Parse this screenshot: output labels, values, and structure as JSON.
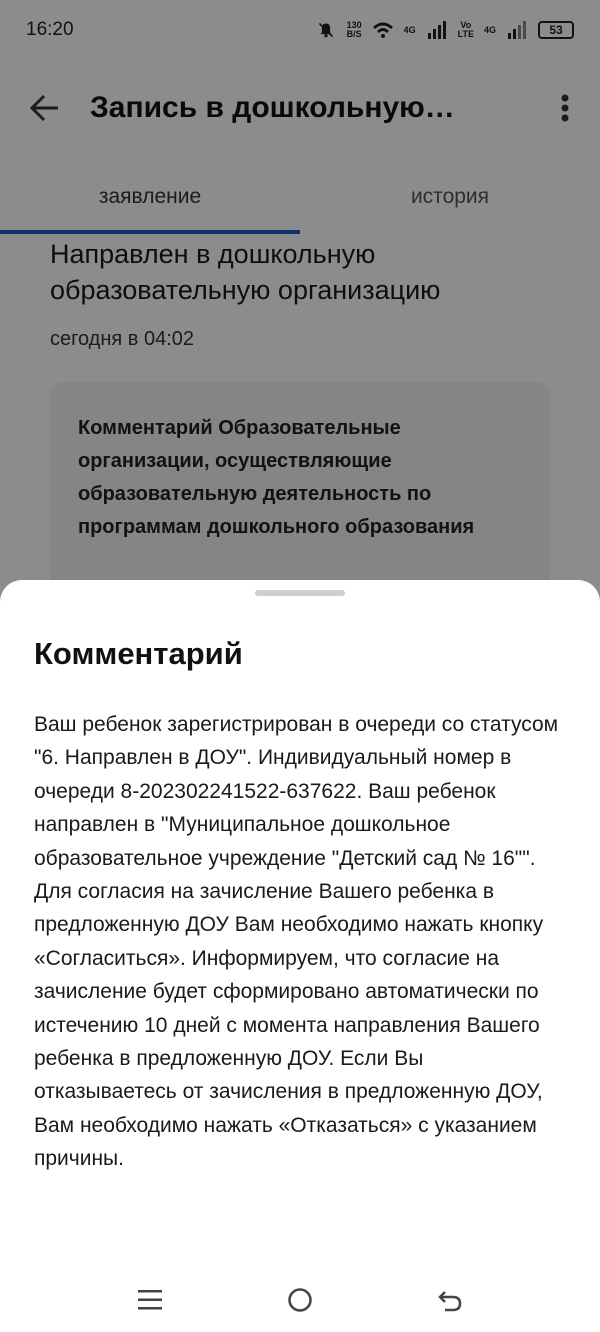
{
  "status_bar": {
    "time": "16:20",
    "net_speed_value": "130",
    "net_speed_unit": "B/S",
    "network1": "4G",
    "volte_top": "Vo",
    "volte_bottom": "LTE",
    "network2": "4G",
    "battery": "53"
  },
  "app_bar": {
    "title": "Запись в дошкольную…"
  },
  "tabs": [
    {
      "label": "заявление",
      "active": true
    },
    {
      "label": "история",
      "active": false
    }
  ],
  "event": {
    "title": "Направлен в дошкольную образовательную организацию",
    "time": "сегодня в 04:02",
    "comment_preview": "Комментарий Образовательные организации, осуществляющие образовательную деятельность по программам дошкольного образования"
  },
  "sheet": {
    "title": "Комментарий",
    "body": "Ваш ребенок зарегистрирован в очереди со статусом \"6. Направлен в ДОУ\". Индивидуальный номер в очереди 8-202302241522-637622. Ваш ребенок направлен в \"Муниципальное дошкольное образовательное учреждение \"Детский сад № 16\"\". Для согласия на зачисление Вашего ребенка в предложенную ДОУ Вам необходимо нажать кнопку «Согласиться». Информируем, что согласие на зачисление будет сформировано автоматически по истечению 10 дней с момента направления Вашего ребенка в предложенную ДОУ. Если Вы отказываетесь от зачисления в предложенную ДОУ, Вам необходимо нажать «Отказаться» с указанием причины."
  },
  "colors": {
    "accent": "#1a56c4",
    "scrim": "rgba(0,0,0,0.45)"
  },
  "icons": {
    "back": "arrow-left-icon",
    "more": "more-vertical-icon",
    "nav_menu": "menu-icon",
    "nav_home": "home-circle-icon",
    "nav_back": "back-icon"
  }
}
